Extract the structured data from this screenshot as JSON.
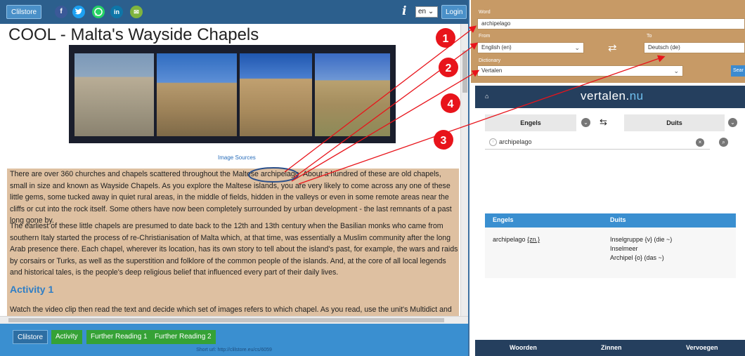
{
  "topbar": {
    "clilstore_label": "Clilstore",
    "social": {
      "facebook": "f",
      "twitter": "t",
      "whatsapp": "w",
      "linkedin": "in",
      "email": "✉"
    },
    "info_icon": "i",
    "language": "en",
    "login_label": "Login"
  },
  "page": {
    "title": "COOL - Malta's Wayside Chapels",
    "image_sources": "Image Sources",
    "para1": "There are over 360 churches and chapels scattered throughout the Maltese archipelago. About a hundred of these are old chapels, small in size and known as Wayside Chapels. As you explore the Maltese islands, you are very likely to come across any one of these little gems, some tucked away in quiet rural areas, in the middle of fields, hidden in the valleys or even in some remote areas near the cliffs or cut into the rock itself. Some others have now been completely surrounded by urban development - the last remnants of a past long gone by.",
    "para2": "The earliest of these little chapels are presumed to date back to the 12th and 13th century when the Basilian monks who came from southern Italy started the process of re-Christianisation of Malta which, at that time, was essentially a Muslim community after the long Arab presence there. Each chapel, wherever its location, has its own story to tell about the island's past, for example, the wars and raids by corsairs or Turks, as well as the superstition and folklore of the common people of the islands.  And, at the core of all local legends and historical tales, is the people's deep religious belief that influenced every part of their daily lives.",
    "activity_heading": "Activity 1",
    "para3": "Watch the video clip then read the text and decide which set of images refers to which chapel. As you read, use the unit's Multidict and"
  },
  "bottombar": {
    "clilstore": "Clilstore",
    "activity": "Activity",
    "further1": "Further Reading 1",
    "further2": "Further Reading 2",
    "short_url": "Short url:  http://clilstore.eu/cs/6059"
  },
  "dict_panel": {
    "word_label": "Word",
    "word_value": "archipelago",
    "from_label": "From",
    "from_value": "English (en)",
    "to_label": "To",
    "to_value": "Deutsch (de)",
    "dictionary_label": "Dictionary",
    "dictionary_value": "Vertalen",
    "search_label": "Sear"
  },
  "vertalen": {
    "logo_main": "vertalen.",
    "logo_nu": "nu",
    "lang_from": "Engels",
    "lang_to": "Duits",
    "search_text": "archipelago",
    "head_from": "Engels",
    "head_to": "Duits",
    "result_word": "archipelago",
    "result_tag": "{zn.}",
    "translations": [
      "Inselgruppe {v} (die ~)",
      "Inselmeer",
      "Archipel {o} (das ~)"
    ],
    "footer_tabs": [
      "Woorden",
      "Zinnen",
      "Vervoegen"
    ]
  },
  "annotations": {
    "markers": [
      "1",
      "2",
      "3",
      "4"
    ],
    "color": "#e8141b"
  }
}
